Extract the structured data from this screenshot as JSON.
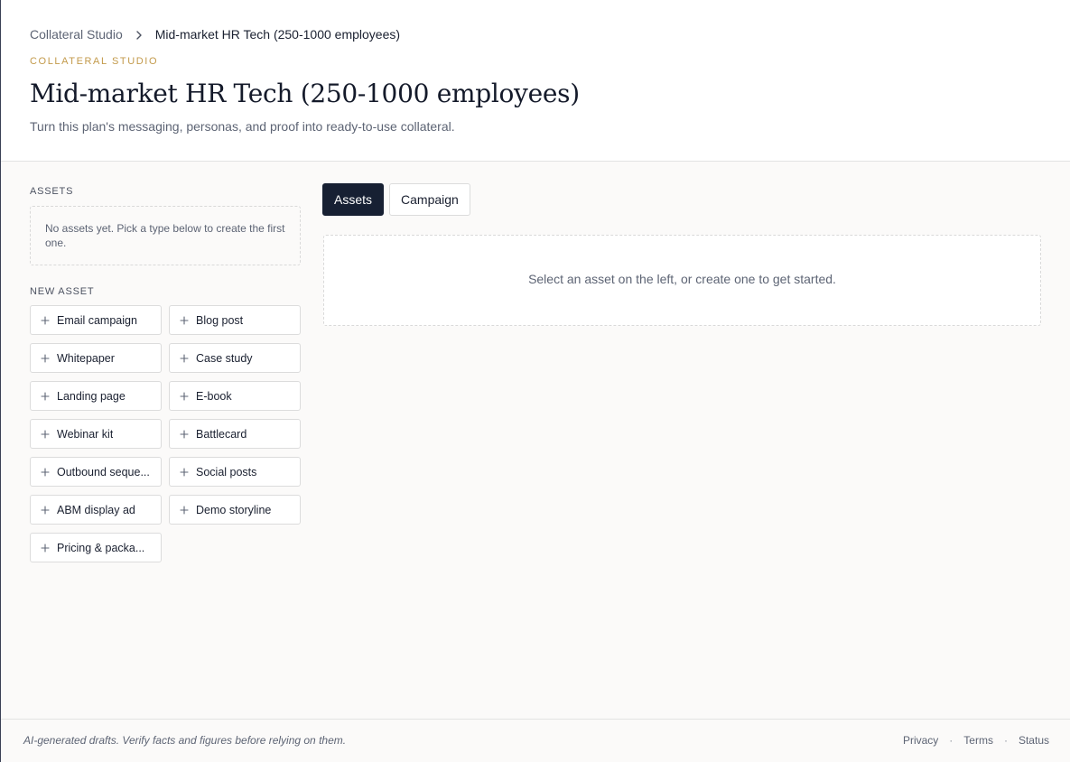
{
  "breadcrumb": {
    "root": "Collateral Studio",
    "current": "Mid-market HR Tech (250-1000 employees)"
  },
  "header": {
    "eyebrow": "COLLATERAL STUDIO",
    "title": "Mid-market HR Tech (250-1000 employees)",
    "subtitle": "Turn this plan's messaging, personas, and proof into ready-to-use collateral."
  },
  "sidebar": {
    "assets_label": "ASSETS",
    "empty_text": "No assets yet. Pick a type below to create the first one.",
    "new_asset_label": "NEW ASSET",
    "new_assets": [
      {
        "label": "Email campaign"
      },
      {
        "label": "Blog post"
      },
      {
        "label": "Whitepaper"
      },
      {
        "label": "Case study"
      },
      {
        "label": "Landing page"
      },
      {
        "label": "E-book"
      },
      {
        "label": "Webinar kit"
      },
      {
        "label": "Battlecard"
      },
      {
        "label": "Outbound seque..."
      },
      {
        "label": "Social posts"
      },
      {
        "label": "ABM display ad"
      },
      {
        "label": "Demo storyline"
      },
      {
        "label": "Pricing & packa..."
      }
    ]
  },
  "tabs": [
    {
      "label": "Assets",
      "active": true
    },
    {
      "label": "Campaign",
      "active": false
    }
  ],
  "main": {
    "empty_text": "Select an asset on the left, or create one to get started."
  },
  "footer": {
    "disclaimer": "AI-generated drafts. Verify facts and figures before relying on them.",
    "links": [
      "Privacy",
      "Terms",
      "Status"
    ]
  },
  "colors": {
    "accent": "#c39a4b",
    "dark": "#172033",
    "muted": "#5d6474",
    "border": "#dcdcdc"
  }
}
